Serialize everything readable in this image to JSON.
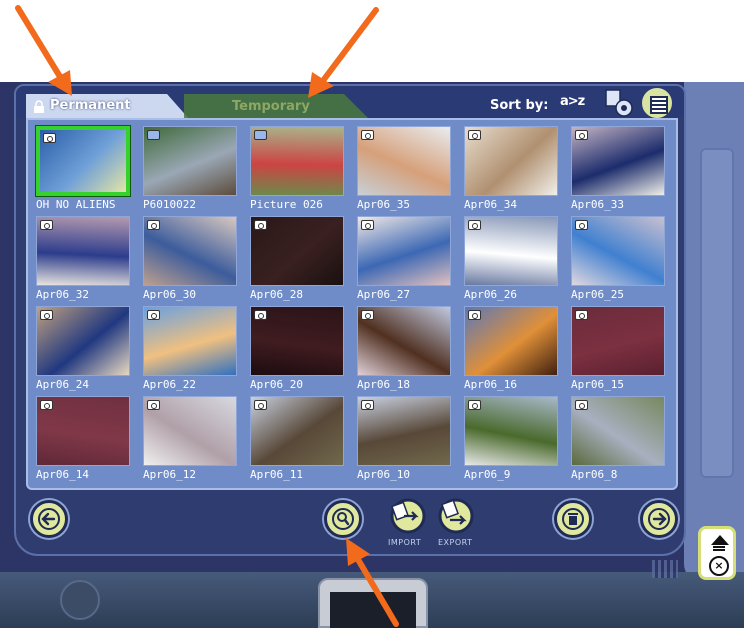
{
  "tabs": [
    {
      "label": "Permanent",
      "active": true
    },
    {
      "label": "Temporary",
      "active": false
    }
  ],
  "sort": {
    "label": "Sort by:",
    "az_label": "a>z"
  },
  "toolbar": {
    "import_label": "IMPORT",
    "export_label": "EXPORT"
  },
  "colors": {
    "selection": "#35d12c",
    "accent_button": "#dfe89c",
    "panel": "#6f8cc8",
    "annotation_arrow": "#f26a1b"
  },
  "thumbnails": [
    {
      "caption": "OH NO ALIENS",
      "icon": "camera-icon",
      "selected": true
    },
    {
      "caption": "P6010022",
      "icon": "photo-icon"
    },
    {
      "caption": "Picture 026",
      "icon": "photo-icon"
    },
    {
      "caption": "Apr06_35",
      "icon": "camera-icon"
    },
    {
      "caption": "Apr06_34",
      "icon": "camera-icon"
    },
    {
      "caption": "Apr06_33",
      "icon": "camera-icon"
    },
    {
      "caption": "Apr06_32",
      "icon": "camera-icon"
    },
    {
      "caption": "Apr06_30",
      "icon": "camera-icon"
    },
    {
      "caption": "Apr06_28",
      "icon": "camera-icon"
    },
    {
      "caption": "Apr06_27",
      "icon": "camera-icon"
    },
    {
      "caption": "Apr06_26",
      "icon": "camera-icon"
    },
    {
      "caption": "Apr06_25",
      "icon": "camera-icon"
    },
    {
      "caption": "Apr06_24",
      "icon": "camera-icon"
    },
    {
      "caption": "Apr06_22",
      "icon": "camera-icon"
    },
    {
      "caption": "Apr06_20",
      "icon": "camera-icon"
    },
    {
      "caption": "Apr06_18",
      "icon": "camera-icon"
    },
    {
      "caption": "Apr06_16",
      "icon": "camera-icon"
    },
    {
      "caption": "Apr06_15",
      "icon": "camera-icon"
    },
    {
      "caption": "Apr06_14",
      "icon": "camera-icon"
    },
    {
      "caption": "Apr06_12",
      "icon": "camera-icon"
    },
    {
      "caption": "Apr06_11",
      "icon": "camera-icon"
    },
    {
      "caption": "Apr06_10",
      "icon": "camera-icon"
    },
    {
      "caption": "Apr06_9",
      "icon": "camera-icon"
    },
    {
      "caption": "Apr06_8",
      "icon": "camera-icon"
    }
  ]
}
